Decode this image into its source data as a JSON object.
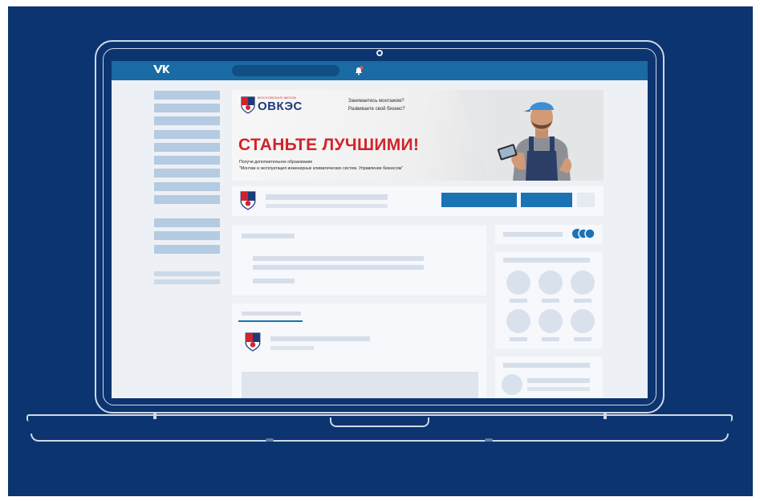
{
  "topbar": {
    "logo_text": "VK",
    "search_placeholder": "",
    "icons": [
      "vk-logo-icon",
      "bell-icon"
    ]
  },
  "banner": {
    "brand_small": "МОСКОВСКАЯ ШКОЛА",
    "brand": "ОВКЭС",
    "question1": "Занимаетесь монтажом?",
    "question2": "Развиваете свой бизнес?",
    "headline": "СТАНЬТЕ ЛУЧШИМИ!",
    "subtitle1": "Получи дополнительное образование",
    "subtitle2": "\"Монтаж и эксплуатация инженерных климатических систем. Управление бизнесом\""
  },
  "colors": {
    "background": "#0c3470",
    "topbar": "#1a6aa3",
    "accent": "#1b73b3",
    "headline_red": "#d3232a",
    "brand_blue": "#1f3a7a"
  }
}
